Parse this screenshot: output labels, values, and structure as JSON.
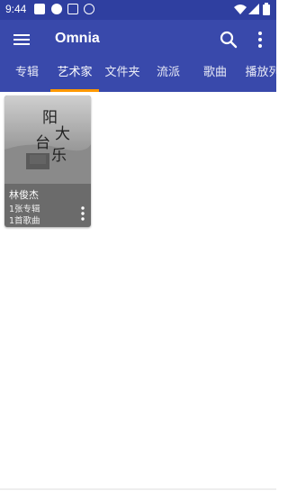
{
  "status_bar": {
    "time": "9:44",
    "notification_icons": [
      "square-notification-icon",
      "alert-circle-icon",
      "a-box-icon",
      "clock-circle-icon"
    ],
    "system_icons": [
      "wifi-icon",
      "signal-icon",
      "battery-icon"
    ]
  },
  "app_bar": {
    "title": "Omnia",
    "menu_icon": "hamburger-menu-icon",
    "search_icon": "search-icon",
    "more_icon": "more-vertical-icon"
  },
  "tabs": [
    {
      "label": "专辑",
      "active": false
    },
    {
      "label": "艺术家",
      "active": true
    },
    {
      "label": "文件夹",
      "active": false
    },
    {
      "label": "流派",
      "active": false
    },
    {
      "label": "歌曲",
      "active": false
    },
    {
      "label": "播放列",
      "active": false
    }
  ],
  "artists": [
    {
      "name": "林俊杰",
      "albums": "1张专辑",
      "songs": "1首歌曲",
      "art_text": "阳台 大大乐"
    }
  ],
  "colors": {
    "status_bar": "#2f3fa0",
    "primary": "#3949ab",
    "tab_indicator": "#ff9800",
    "card_footer": "#6b6b6b"
  }
}
